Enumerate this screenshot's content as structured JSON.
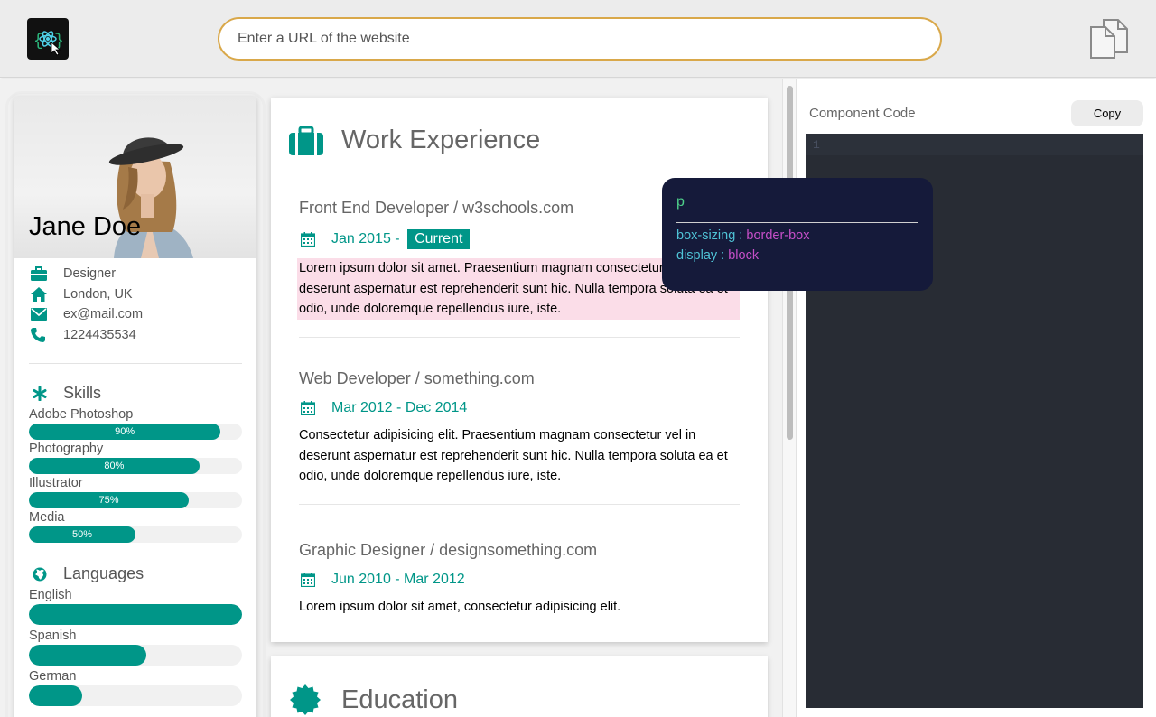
{
  "toolbar": {
    "logo_icon": "react-atom-logo-icon",
    "url_placeholder": "Enter a URL of the website",
    "copy_icon": "copy-document-icon"
  },
  "profile": {
    "name": "Jane Doe",
    "info": [
      {
        "icon": "briefcase-icon",
        "text": "Designer"
      },
      {
        "icon": "home-icon",
        "text": "London, UK"
      },
      {
        "icon": "envelope-icon",
        "text": "ex@mail.com"
      },
      {
        "icon": "phone-icon",
        "text": "1224435534"
      }
    ],
    "skills_title": "Skills",
    "skills": [
      {
        "label": "Adobe Photoshop",
        "percent": "90%",
        "value": 90
      },
      {
        "label": "Photography",
        "percent": "80%",
        "value": 80
      },
      {
        "label": "Illustrator",
        "percent": "75%",
        "value": 75
      },
      {
        "label": "Media",
        "percent": "50%",
        "value": 50
      }
    ],
    "languages_title": "Languages",
    "languages": [
      {
        "label": "English",
        "value": 100
      },
      {
        "label": "Spanish",
        "value": 55
      },
      {
        "label": "German",
        "value": 25
      }
    ]
  },
  "work": {
    "title": "Work Experience",
    "jobs": [
      {
        "title": "Front End Developer / w3schools.com",
        "date": "Jan 2015 - ",
        "badge": "Current",
        "desc": "Lorem ipsum dolor sit amet. Praesentium magnam consectetur vel in deserunt aspernatur est reprehenderit sunt hic. Nulla tempora soluta ea et odio, unde doloremque repellendus iure, iste."
      },
      {
        "title": "Web Developer / something.com",
        "date": "Mar 2012 - Dec 2014",
        "desc": "Consectetur adipisicing elit. Praesentium magnam consectetur vel in deserunt aspernatur est reprehenderit sunt hic. Nulla tempora soluta ea et odio, unde doloremque repellendus iure, iste."
      },
      {
        "title": "Graphic Designer / designsomething.com",
        "date": "Jun 2010 - Mar 2012",
        "desc": "Lorem ipsum dolor sit amet, consectetur adipisicing elit."
      }
    ]
  },
  "education": {
    "title": "Education"
  },
  "tooltip": {
    "tag": "p",
    "props": [
      {
        "key": "box-sizing",
        "sep": " : ",
        "value": "border-box"
      },
      {
        "key": "display",
        "sep": " : ",
        "value": "block"
      }
    ]
  },
  "code_panel": {
    "label": "Component Code",
    "copy_label": "Copy",
    "line_number": "1"
  },
  "colors": {
    "accent": "#009688",
    "url_border": "#d9a84a",
    "tooltip_bg": "#151a3a",
    "editor_bg": "#282c34",
    "highlight": "#fbdde8"
  }
}
